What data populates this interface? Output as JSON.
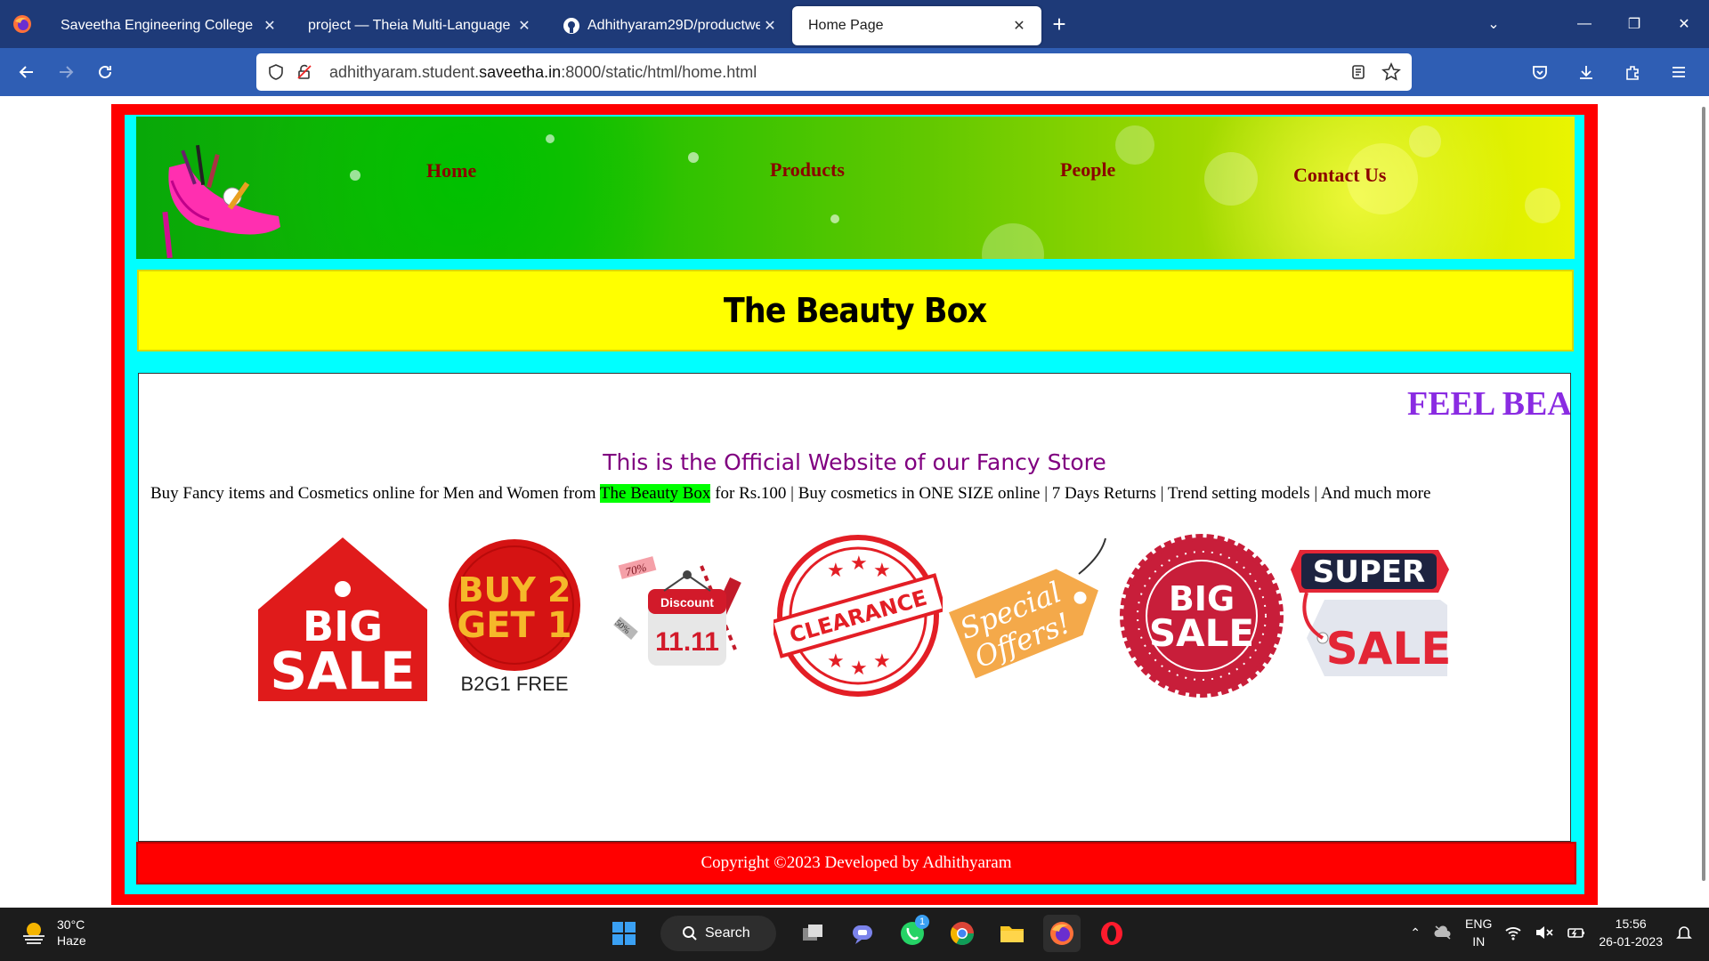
{
  "browser": {
    "tabs": [
      {
        "title": "Saveetha Engineering College",
        "active": false
      },
      {
        "title": "project — Theia Multi-Language Ex",
        "active": false
      },
      {
        "title": "Adhithyaram29D/productweb",
        "active": false
      },
      {
        "title": "Home Page",
        "active": true
      }
    ],
    "url_prefix": "adhithyaram.student.",
    "url_domain": "saveetha.in",
    "url_suffix": ":8000/static/html/home.html"
  },
  "site": {
    "nav": {
      "home": "Home",
      "products": "Products",
      "people": "People",
      "contact": "Contact Us"
    },
    "title": "The Beauty Box",
    "marquee": "FEEL BEA",
    "tagline": "This is the Official Website of our Fancy Store",
    "desc_before": "Buy Fancy items and Cosmetics online for Men and Women from ",
    "desc_highlight": "The Beauty Box",
    "desc_after": " for Rs.100 | Buy cosmetics in ONE SIZE online | 7 Days Returns | Trend setting models | And much more",
    "badges": {
      "big_sale_1_line1": "BIG",
      "big_sale_1_line2": "SALE",
      "b2g1_line1": "BUY 2",
      "b2g1_line2": "GET 1",
      "b2g1_caption": "B2G1 FREE",
      "discount_label": "Discount",
      "discount_date": "11.11",
      "discount_pct1": "70%",
      "discount_pct2": "50%",
      "clearance": "CLEARANCE",
      "special_line1": "Special",
      "special_line2": "Offers!",
      "big_sale_2_line1": "BIG",
      "big_sale_2_line2": "SALE",
      "super": "SUPER",
      "super_sale": "SALE"
    },
    "footer": "Copyright ©2023 Developed by Adhithyaram"
  },
  "taskbar": {
    "temp": "30°C",
    "weather": "Haze",
    "search": "Search",
    "whatsapp_badge": "1",
    "lang1": "ENG",
    "lang2": "IN",
    "time": "15:56",
    "date": "26-01-2023"
  },
  "colors": {
    "chrome_tabbar": "#1e3a78",
    "chrome_nav": "#2f5eb4",
    "frame_red": "#ff0000",
    "frame_cyan": "#00ffff",
    "title_yellow": "#ffff00",
    "nav_link": "#8b0000",
    "marquee": "#8a2be2",
    "tagline": "#800080",
    "highlight": "#00ff00"
  }
}
